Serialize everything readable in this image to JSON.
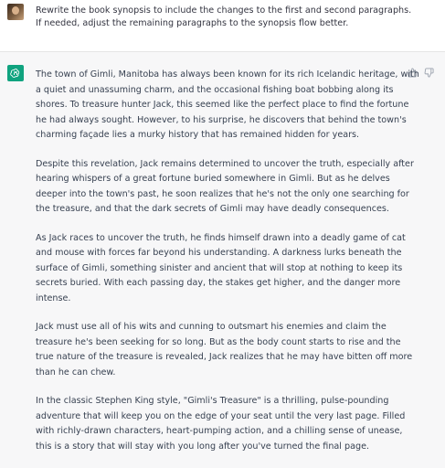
{
  "user_message": {
    "text": "Rewrite the book synopsis to include the changes to the first and second paragraphs.  If needed, adjust the remaining paragraphs to the synopsis flow better."
  },
  "assistant_message": {
    "paragraphs": [
      "The town of Gimli, Manitoba has always been known for its rich Icelandic heritage, with a quiet and unassuming charm, and the occasional fishing boat bobbing along its shores. To treasure hunter Jack, this seemed like the perfect place to find the fortune he had always sought. However, to his surprise, he discovers that behind the town's charming façade lies a murky history that has remained hidden for years.",
      "Despite this revelation, Jack remains determined to uncover the truth, especially after hearing whispers of a great fortune buried somewhere in Gimli. But as he delves deeper into the town's past, he soon realizes that he's not the only one searching for the treasure, and that the dark secrets of Gimli may have deadly consequences.",
      "As Jack races to uncover the truth, he finds himself drawn into a deadly game of cat and mouse with forces far beyond his understanding. A darkness lurks beneath the surface of Gimli, something sinister and ancient that will stop at nothing to keep its secrets buried. With each passing day, the stakes get higher, and the danger more intense.",
      "Jack must use all of his wits and cunning to outsmart his enemies and claim the treasure he's been seeking for so long. But as the body count starts to rise and the true nature of the treasure is revealed, Jack realizes that he may have bitten off more than he can chew.",
      "In the classic Stephen King style, \"Gimli's Treasure\" is a thrilling, pulse-pounding adventure that will keep you on the edge of your seat until the very last page. Filled with richly-drawn characters, heart-pumping action, and a chilling sense of unease, this is a story that will stay with you long after you've turned the final page."
    ]
  },
  "icons": {
    "user_avatar": "user-avatar",
    "bot_avatar": "openai-logo-icon",
    "thumbs_up": "thumbs-up-icon",
    "thumbs_down": "thumbs-down-icon"
  },
  "colors": {
    "assistant_bg": "#f7f7f8",
    "user_bg": "#ffffff",
    "bot_avatar_bg": "#10a37f",
    "text": "#374151"
  }
}
